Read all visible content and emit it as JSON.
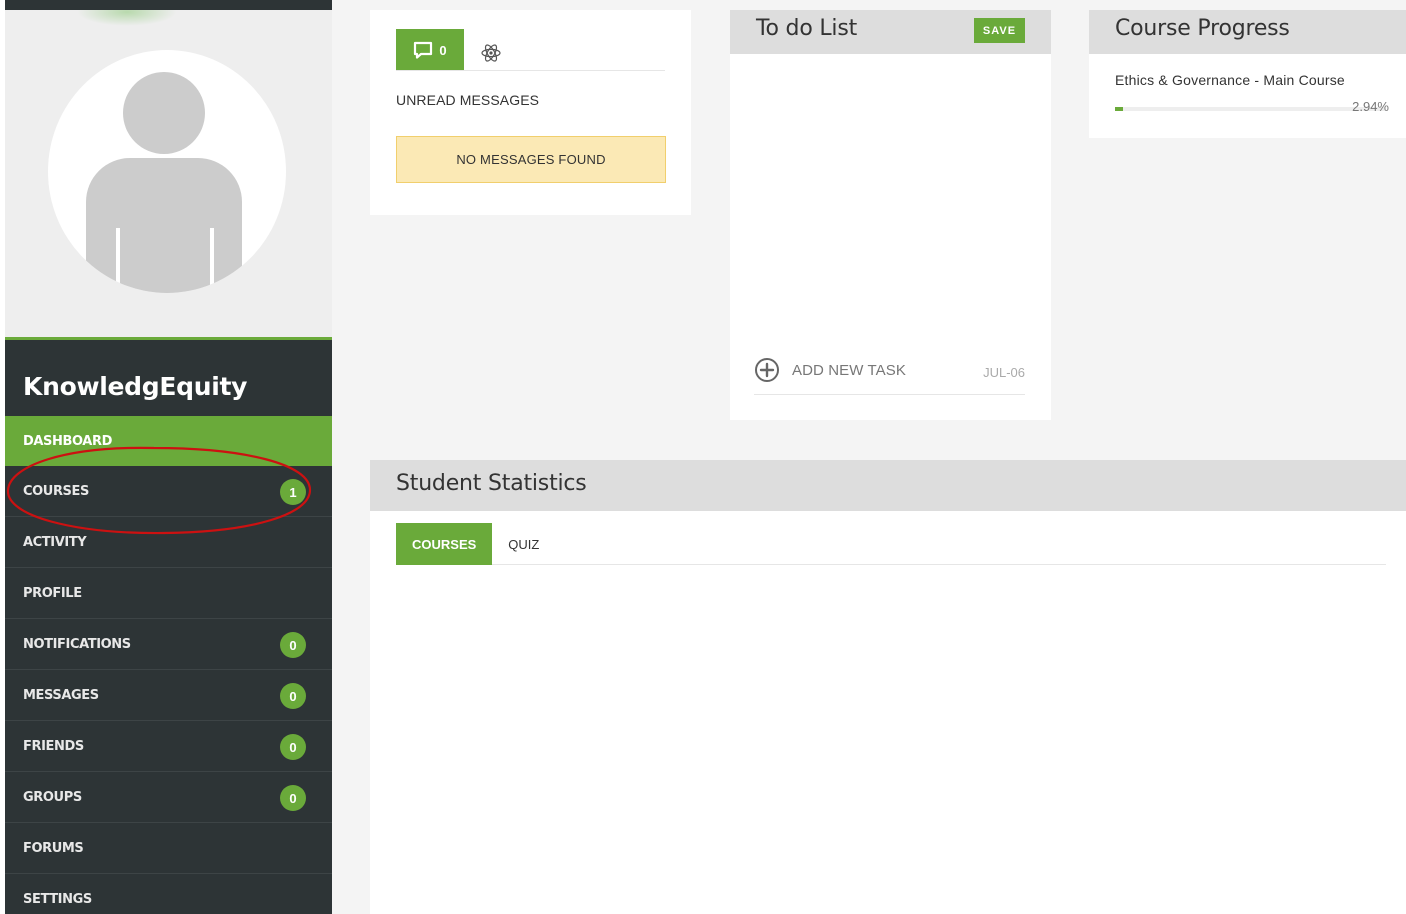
{
  "sidebar": {
    "site_title": "KnowledgEquity",
    "nav": [
      {
        "label": "DASHBOARD",
        "active": true,
        "badge": null
      },
      {
        "label": "COURSES",
        "active": false,
        "badge": "1"
      },
      {
        "label": "ACTIVITY",
        "active": false,
        "badge": null
      },
      {
        "label": "PROFILE",
        "active": false,
        "badge": null
      },
      {
        "label": "NOTIFICATIONS",
        "active": false,
        "badge": "0"
      },
      {
        "label": "MESSAGES",
        "active": false,
        "badge": "0"
      },
      {
        "label": "FRIENDS",
        "active": false,
        "badge": "0"
      },
      {
        "label": "GROUPS",
        "active": false,
        "badge": "0"
      },
      {
        "label": "FORUMS",
        "active": false,
        "badge": null
      },
      {
        "label": "SETTINGS",
        "active": false,
        "badge": null
      }
    ]
  },
  "messages": {
    "count": "0",
    "unread_label": "UNREAD MESSAGES",
    "empty_text": "NO MESSAGES FOUND"
  },
  "todo": {
    "title": "To do List",
    "save_label": "SAVE",
    "add_task_label": "ADD NEW TASK",
    "date": "JUL-06"
  },
  "progress": {
    "title": "Course Progress",
    "course_name": "Ethics & Governance - Main Course",
    "percent_label": "2.94%",
    "percent_value": 2.94
  },
  "stats": {
    "title": "Student Statistics",
    "tabs": [
      {
        "label": "COURSES",
        "active": true
      },
      {
        "label": "QUIZ",
        "active": false
      }
    ]
  },
  "colors": {
    "accent": "#6aaa3a",
    "sidebar_bg": "#2d3436",
    "notice_bg": "#fbe9b5",
    "annotation": "#cc1111"
  }
}
